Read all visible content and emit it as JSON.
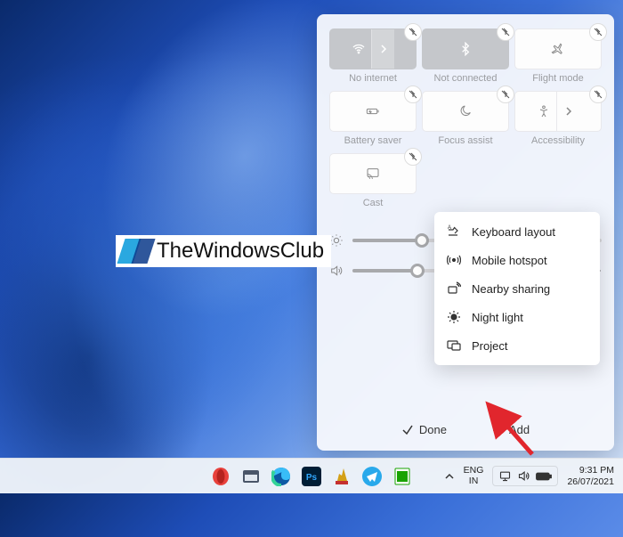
{
  "quick_settings": {
    "tiles": [
      {
        "id": "wifi",
        "label": "No internet",
        "style": "dim",
        "has_chevron": true
      },
      {
        "id": "bluetooth",
        "label": "Not connected",
        "style": "dim",
        "has_chevron": false
      },
      {
        "id": "airplane",
        "label": "Flight mode",
        "style": "light",
        "has_chevron": false
      },
      {
        "id": "battery-saver",
        "label": "Battery saver",
        "style": "light",
        "has_chevron": false
      },
      {
        "id": "focus-assist",
        "label": "Focus assist",
        "style": "light",
        "has_chevron": false
      },
      {
        "id": "accessibility",
        "label": "Accessibility",
        "style": "light",
        "has_chevron": true
      },
      {
        "id": "cast",
        "label": "Cast",
        "style": "light",
        "has_chevron": false
      }
    ],
    "sliders": {
      "brightness": 28,
      "volume": 28
    },
    "footer": {
      "done_label": "Done",
      "add_label": "Add"
    },
    "add_menu": [
      {
        "icon": "keyboard-layout",
        "label": "Keyboard layout"
      },
      {
        "icon": "mobile-hotspot",
        "label": "Mobile hotspot"
      },
      {
        "icon": "nearby-sharing",
        "label": "Nearby sharing"
      },
      {
        "icon": "night-light",
        "label": "Night light"
      },
      {
        "icon": "project",
        "label": "Project"
      }
    ]
  },
  "watermark": {
    "text": "TheWindowsClub"
  },
  "taskbar": {
    "language": {
      "line1": "ENG",
      "line2": "IN"
    },
    "clock": {
      "time": "9:31 PM",
      "date": "26/07/2021"
    }
  }
}
